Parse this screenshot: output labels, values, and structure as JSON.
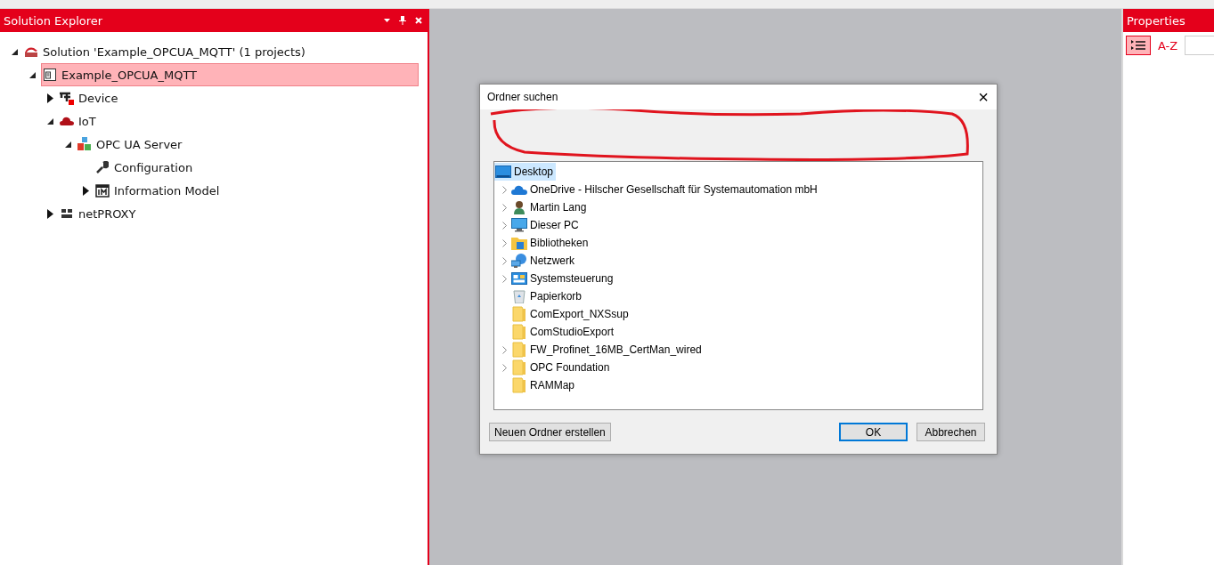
{
  "solution_explorer": {
    "title": "Solution Explorer",
    "tree": [
      {
        "label": "Solution 'Example_OPCUA_MQTT' (1 projects)",
        "kind": "solution",
        "expanded": true,
        "selected": false,
        "children": [
          {
            "label": "Example_OPCUA_MQTT",
            "kind": "project",
            "expanded": true,
            "selected": true,
            "children": [
              {
                "label": "Device",
                "kind": "device",
                "expanded": false,
                "selected": false
              },
              {
                "label": "IoT",
                "kind": "cloud",
                "expanded": true,
                "selected": false,
                "children": [
                  {
                    "label": "OPC UA Server",
                    "kind": "opc",
                    "expanded": true,
                    "selected": false,
                    "children": [
                      {
                        "label": "Configuration",
                        "kind": "wrench",
                        "selected": false
                      },
                      {
                        "label": "Information Model",
                        "kind": "model",
                        "expanded": false,
                        "selected": false
                      }
                    ]
                  }
                ]
              },
              {
                "label": "netPROXY",
                "kind": "proxy",
                "expanded": false,
                "selected": false
              }
            ]
          }
        ]
      }
    ]
  },
  "properties": {
    "title": "Properties",
    "sort_categorized_selected": true,
    "sort_alpha": "A-Z"
  },
  "dialog": {
    "title": "Ordner suchen",
    "close": "×",
    "folders": [
      {
        "label": "Desktop",
        "kind": "desktop",
        "selected": true,
        "children": [
          {
            "label": "OneDrive - Hilscher Gesellschaft für Systemautomation mbH",
            "kind": "onedrive",
            "expandable": true,
            "selected": false
          },
          {
            "label": "Martin Lang",
            "kind": "user",
            "expandable": true,
            "selected": false
          },
          {
            "label": "Dieser PC",
            "kind": "pc",
            "expandable": true,
            "selected": false
          },
          {
            "label": "Bibliotheken",
            "kind": "library",
            "expandable": true,
            "selected": false
          },
          {
            "label": "Netzwerk",
            "kind": "network",
            "expandable": true,
            "selected": false
          },
          {
            "label": "Systemsteuerung",
            "kind": "control",
            "expandable": true,
            "selected": false
          },
          {
            "label": "Papierkorb",
            "kind": "bin",
            "expandable": false,
            "selected": false
          },
          {
            "label": "ComExport_NXSsup",
            "kind": "folder",
            "expandable": false,
            "selected": false
          },
          {
            "label": "ComStudioExport",
            "kind": "folder",
            "expandable": false,
            "selected": false
          },
          {
            "label": "FW_Profinet_16MB_CertMan_wired",
            "kind": "folder",
            "expandable": true,
            "selected": false
          },
          {
            "label": "OPC Foundation",
            "kind": "folder",
            "expandable": true,
            "selected": false
          },
          {
            "label": "RAMMap",
            "kind": "folder",
            "expandable": false,
            "selected": false
          }
        ]
      }
    ],
    "buttons": [
      {
        "label": "Neuen Ordner erstellen",
        "kind": "secondary"
      },
      {
        "label": "OK",
        "kind": "default"
      },
      {
        "label": "Abbrechen",
        "kind": "secondary"
      }
    ]
  }
}
